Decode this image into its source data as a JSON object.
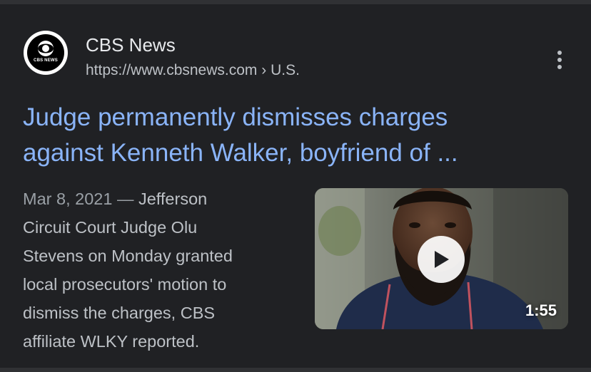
{
  "result": {
    "source": {
      "name": "CBS News",
      "url": "https://www.cbsnews.com",
      "breadcrumb_sep": "›",
      "breadcrumb": "U.S.",
      "favicon_text": "CBS NEWS",
      "favicon_icon": "cbs-eye-logo"
    },
    "menu_icon": "more-vert-icon",
    "title_line1": "Judge permanently dismisses charges",
    "title_line2": "against Kenneth Walker, boyfriend of ...",
    "snippet": {
      "date": "Mar 8, 2021",
      "dash": "—",
      "line1_rest": "Jefferson",
      "line2": "Circuit Court Judge Olu",
      "line3": "Stevens on Monday granted",
      "line4": "local prosecutors' motion to",
      "line5": "dismiss the charges, CBS",
      "line6": "affiliate WLKY reported."
    },
    "video": {
      "duration": "1:55",
      "play_icon": "play-icon"
    }
  },
  "colors": {
    "background": "#202124",
    "title_link": "#8ab4f8",
    "text": "#bdc1c6",
    "site_name": "#e8eaed"
  }
}
